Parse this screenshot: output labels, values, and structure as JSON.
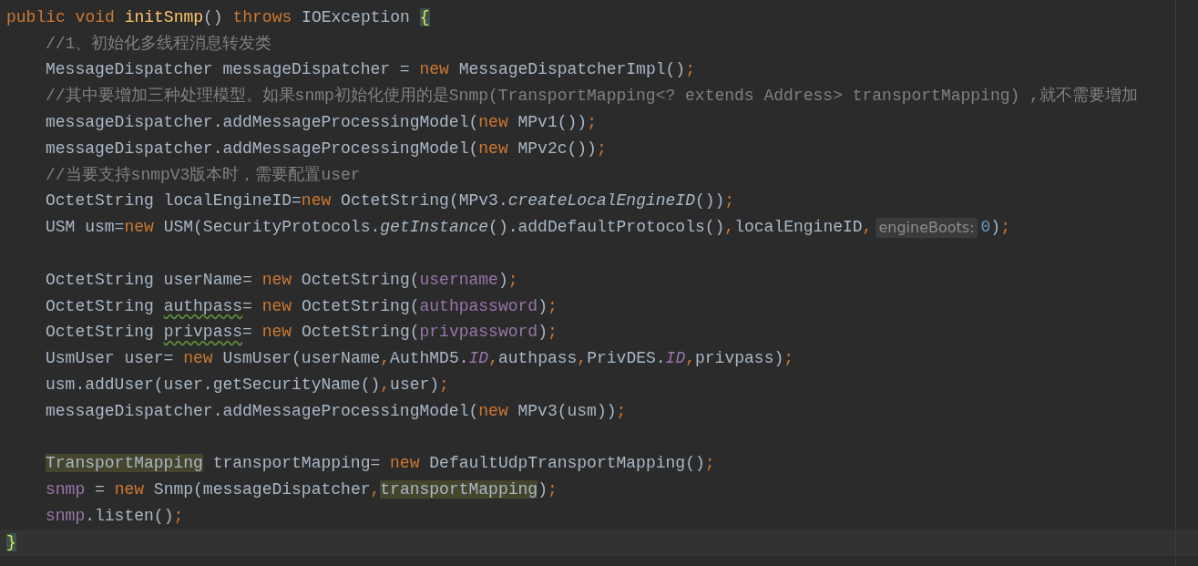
{
  "editor": {
    "lines": [
      {
        "kind": "code",
        "current": false,
        "tokens": [
          {
            "text": "public void ",
            "kind": "keyword"
          },
          {
            "text": "initSnmp",
            "kind": "method_decl"
          },
          {
            "text": "() ",
            "kind": "plain"
          },
          {
            "text": "throws ",
            "kind": "keyword"
          },
          {
            "text": "IOException ",
            "kind": "plain"
          },
          {
            "text": "{",
            "kind": "brace_match"
          }
        ]
      },
      {
        "kind": "block",
        "children": [
          {
            "kind": "code",
            "current": false,
            "tokens": [
              {
                "text": "//1、初始化多线程消息转发类",
                "kind": "comment"
              }
            ]
          },
          {
            "kind": "code",
            "current": false,
            "tokens": [
              {
                "text": "MessageDispatcher messageDispatcher = ",
                "kind": "plain"
              },
              {
                "text": "new ",
                "kind": "keyword"
              },
              {
                "text": "MessageDispatcherImpl()",
                "kind": "plain"
              },
              {
                "text": ";",
                "kind": "punct"
              }
            ]
          },
          {
            "kind": "code",
            "current": false,
            "tokens": [
              {
                "text": "//其中要增加三种处理模型。如果snmp初始化使用的是Snmp(TransportMapping<? extends Address> transportMapping) ,就不需要增加",
                "kind": "comment"
              }
            ]
          },
          {
            "kind": "code",
            "current": false,
            "tokens": [
              {
                "text": "messageDispatcher.addMessageProcessingModel(",
                "kind": "plain"
              },
              {
                "text": "new ",
                "kind": "keyword"
              },
              {
                "text": "MPv1())",
                "kind": "plain"
              },
              {
                "text": ";",
                "kind": "punct"
              }
            ]
          },
          {
            "kind": "code",
            "current": false,
            "tokens": [
              {
                "text": "messageDispatcher.addMessageProcessingModel(",
                "kind": "plain"
              },
              {
                "text": "new ",
                "kind": "keyword"
              },
              {
                "text": "MPv2c())",
                "kind": "plain"
              },
              {
                "text": ";",
                "kind": "punct"
              }
            ]
          },
          {
            "kind": "code",
            "current": false,
            "tokens": [
              {
                "text": "//当要支持snmpV3版本时，需要配置user",
                "kind": "comment"
              }
            ]
          },
          {
            "kind": "code",
            "current": false,
            "tokens": [
              {
                "text": "OctetString localEngineID=",
                "kind": "plain"
              },
              {
                "text": "new ",
                "kind": "keyword"
              },
              {
                "text": "OctetString(MPv3.",
                "kind": "plain"
              },
              {
                "text": "createLocalEngineID",
                "kind": "static_call"
              },
              {
                "text": "())",
                "kind": "plain"
              },
              {
                "text": ";",
                "kind": "punct"
              }
            ]
          },
          {
            "kind": "code",
            "current": false,
            "tokens": [
              {
                "text": "USM usm=",
                "kind": "plain"
              },
              {
                "text": "new ",
                "kind": "keyword"
              },
              {
                "text": "USM(SecurityProtocols.",
                "kind": "plain"
              },
              {
                "text": "getInstance",
                "kind": "static_call"
              },
              {
                "text": "().addDefaultProtocols()",
                "kind": "plain"
              },
              {
                "text": ",",
                "kind": "punct"
              },
              {
                "text": "localEngineID",
                "kind": "plain"
              },
              {
                "text": ",",
                "kind": "punct"
              },
              {
                "text": "engineBoots:",
                "kind": "hint"
              },
              {
                "text": "0",
                "kind": "number"
              },
              {
                "text": ")",
                "kind": "plain"
              },
              {
                "text": ";",
                "kind": "punct"
              }
            ]
          },
          {
            "kind": "blank"
          },
          {
            "kind": "code",
            "current": false,
            "tokens": [
              {
                "text": "OctetString userName= ",
                "kind": "plain"
              },
              {
                "text": "new ",
                "kind": "keyword"
              },
              {
                "text": "OctetString(",
                "kind": "plain"
              },
              {
                "text": "username",
                "kind": "field"
              },
              {
                "text": ")",
                "kind": "plain"
              },
              {
                "text": ";",
                "kind": "punct"
              }
            ]
          },
          {
            "kind": "code",
            "current": false,
            "tokens": [
              {
                "text": "OctetString ",
                "kind": "plain"
              },
              {
                "text": "authpass",
                "kind": "typo"
              },
              {
                "text": "= ",
                "kind": "plain"
              },
              {
                "text": "new ",
                "kind": "keyword"
              },
              {
                "text": "OctetString(",
                "kind": "plain"
              },
              {
                "text": "authpassword",
                "kind": "field"
              },
              {
                "text": ")",
                "kind": "plain"
              },
              {
                "text": ";",
                "kind": "punct"
              }
            ]
          },
          {
            "kind": "code",
            "current": false,
            "tokens": [
              {
                "text": "OctetString ",
                "kind": "plain"
              },
              {
                "text": "privpass",
                "kind": "typo"
              },
              {
                "text": "= ",
                "kind": "plain"
              },
              {
                "text": "new ",
                "kind": "keyword"
              },
              {
                "text": "OctetString(",
                "kind": "plain"
              },
              {
                "text": "privpassword",
                "kind": "field"
              },
              {
                "text": ")",
                "kind": "plain"
              },
              {
                "text": ";",
                "kind": "punct"
              }
            ]
          },
          {
            "kind": "code",
            "current": false,
            "tokens": [
              {
                "text": "UsmUser user= ",
                "kind": "plain"
              },
              {
                "text": "new ",
                "kind": "keyword"
              },
              {
                "text": "UsmUser(userName",
                "kind": "plain"
              },
              {
                "text": ",",
                "kind": "punct"
              },
              {
                "text": "AuthMD5.",
                "kind": "plain"
              },
              {
                "text": "ID",
                "kind": "static_field"
              },
              {
                "text": ",",
                "kind": "punct"
              },
              {
                "text": "authpass",
                "kind": "plain"
              },
              {
                "text": ",",
                "kind": "punct"
              },
              {
                "text": "PrivDES.",
                "kind": "plain"
              },
              {
                "text": "ID",
                "kind": "static_field"
              },
              {
                "text": ",",
                "kind": "punct"
              },
              {
                "text": "privpass)",
                "kind": "plain"
              },
              {
                "text": ";",
                "kind": "punct"
              }
            ]
          },
          {
            "kind": "code",
            "current": false,
            "tokens": [
              {
                "text": "usm.addUser(user.getSecurityName()",
                "kind": "plain"
              },
              {
                "text": ",",
                "kind": "punct"
              },
              {
                "text": "user)",
                "kind": "plain"
              },
              {
                "text": ";",
                "kind": "punct"
              }
            ]
          },
          {
            "kind": "code",
            "current": false,
            "tokens": [
              {
                "text": "messageDispatcher.addMessageProcessingModel(",
                "kind": "plain"
              },
              {
                "text": "new ",
                "kind": "keyword"
              },
              {
                "text": "MPv3(usm))",
                "kind": "plain"
              },
              {
                "text": ";",
                "kind": "punct"
              }
            ]
          },
          {
            "kind": "blank"
          },
          {
            "kind": "code",
            "current": false,
            "tokens": [
              {
                "text": "TransportMapping",
                "kind": "usage"
              },
              {
                "text": " transportMapping= ",
                "kind": "plain"
              },
              {
                "text": "new ",
                "kind": "keyword"
              },
              {
                "text": "DefaultUdpTransportMapping()",
                "kind": "plain"
              },
              {
                "text": ";",
                "kind": "punct"
              }
            ]
          },
          {
            "kind": "code",
            "current": false,
            "tokens": [
              {
                "text": "snmp",
                "kind": "field"
              },
              {
                "text": " = ",
                "kind": "plain"
              },
              {
                "text": "new ",
                "kind": "keyword"
              },
              {
                "text": "Snmp(messageDispatcher",
                "kind": "plain"
              },
              {
                "text": ",",
                "kind": "punct"
              },
              {
                "text": "transportMapping",
                "kind": "usage"
              },
              {
                "text": ")",
                "kind": "plain"
              },
              {
                "text": ";",
                "kind": "punct"
              }
            ]
          },
          {
            "kind": "code",
            "current": false,
            "tokens": [
              {
                "text": "snmp",
                "kind": "field"
              },
              {
                "text": ".listen()",
                "kind": "plain"
              },
              {
                "text": ";",
                "kind": "punct"
              }
            ]
          }
        ]
      },
      {
        "kind": "code",
        "current": true,
        "tokens": [
          {
            "text": "}",
            "kind": "brace_match"
          }
        ]
      }
    ]
  }
}
